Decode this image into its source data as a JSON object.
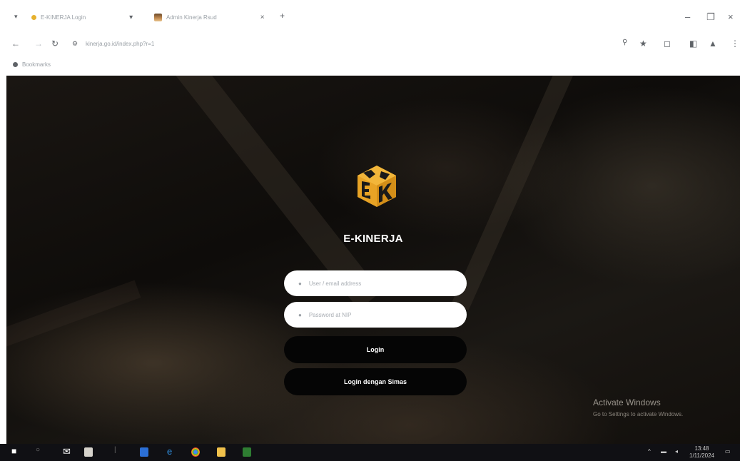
{
  "browser": {
    "tabs": [
      {
        "title": "E-KINERJA Login",
        "icon": "site-favicon"
      },
      {
        "title": "Admin Kinerja Rsud",
        "icon": "avatar-favicon"
      }
    ],
    "new_tab": "+",
    "url": "kinerja.go.id/index.php?r=1",
    "bookmark": "Bookmarks"
  },
  "page": {
    "app_title": "E-KINERJA",
    "username_placeholder": "User / email address",
    "password_placeholder": "Password at NIP",
    "login_button": "Login",
    "login_alt_button": "Login dengan Simas"
  },
  "watermark": {
    "title": "Activate Windows",
    "subtitle": "Go to Settings to activate Windows."
  },
  "taskbar": {
    "clock_time": "13:48",
    "clock_date": "1/11/2024"
  },
  "colors": {
    "logo_gold": "#E8A325",
    "logo_dark": "#1a1a1a",
    "button_bg": "#050505"
  }
}
